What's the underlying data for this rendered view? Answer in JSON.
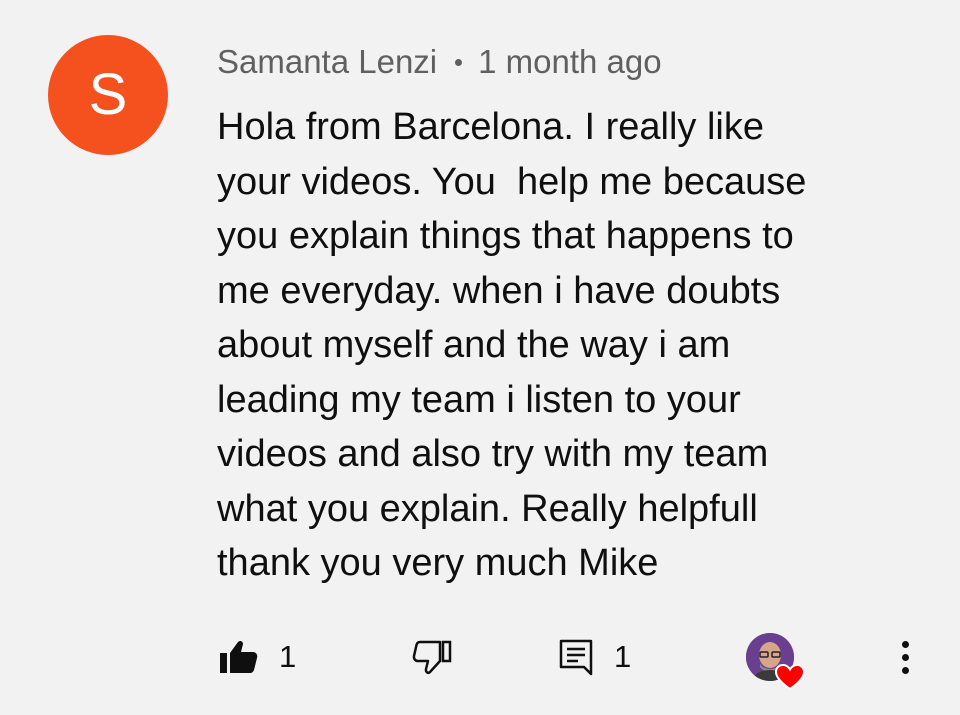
{
  "comment": {
    "avatar_letter": "S",
    "avatar_color": "#f4511e",
    "author": "Samanta Lenzi",
    "timestamp": "1 month ago",
    "text": "Hola from Barcelona. I really like\nyour videos. You  help me because\nyou explain things that happens to\nme everyday. when i have doubts\nabout myself and the way i am\nleading my team i listen to your\nvideos and also try with my team\nwhat you explain. Really helpfull\nthank you very much Mike"
  },
  "actions": {
    "like_count": "1",
    "reply_count": "1",
    "icons": {
      "like": "thumbs-up-filled-icon",
      "dislike": "thumbs-down-outline-icon",
      "reply": "reply-comment-icon",
      "creator_heart": "creator-heart-icon",
      "more": "more-vertical-icon"
    },
    "heart_color": "#ff0000"
  }
}
